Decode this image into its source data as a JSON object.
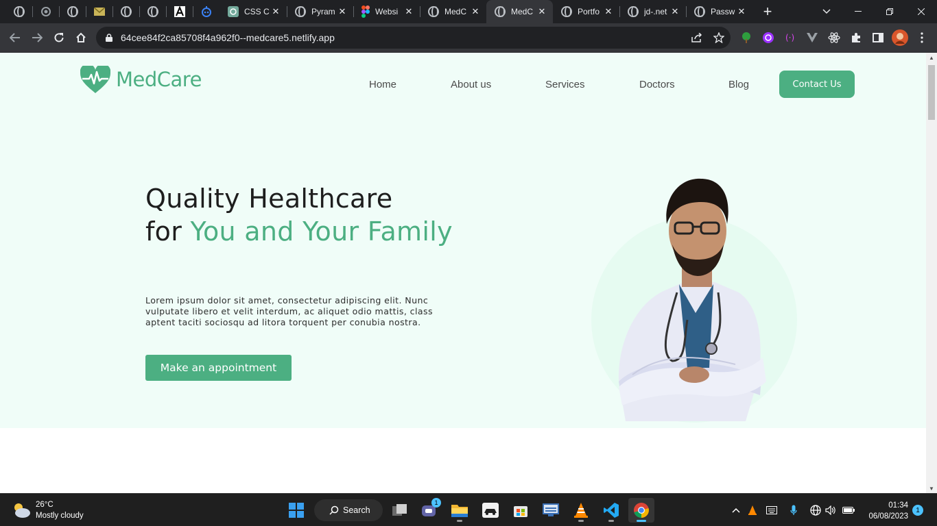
{
  "browser": {
    "tabs": [
      {
        "title": "CSS C",
        "icon": "openai-icon"
      },
      {
        "title": "Pyram",
        "icon": "globe-icon"
      },
      {
        "title": "Websi",
        "icon": "figma-icon"
      },
      {
        "title": "MedC",
        "icon": "globe-icon"
      },
      {
        "title": "MedC",
        "icon": "globe-icon",
        "active": true
      },
      {
        "title": "Portfo",
        "icon": "globe-icon"
      },
      {
        "title": "jd-.net",
        "icon": "globe-icon"
      },
      {
        "title": "Passw",
        "icon": "globe-icon"
      }
    ],
    "close_glyph": "✕",
    "new_tab_glyph": "+",
    "url": "64cee84f2ca85708f4a962f0--medcare5.netlify.app",
    "colors": {
      "tabstrip": "#202124",
      "toolbar": "#35363a"
    }
  },
  "site": {
    "brand": "MedCare",
    "nav": [
      "Home",
      "About us",
      "Services",
      "Doctors",
      "Blog"
    ],
    "contact_label": "Contact Us",
    "hero": {
      "title_line1": "Quality Healthcare",
      "title_for": "for ",
      "title_accent": "You and Your Family",
      "description": "Lorem ipsum dolor sit amet, consectetur adipiscing elit. Nunc vulputate libero et velit interdum, ac aliquet odio mattis, class aptent taciti sociosqu ad litora torquent per conubia nostra.",
      "cta": "Make an appointment"
    },
    "colors": {
      "accent": "#4caf82",
      "hero_bg": "#f0fdf8",
      "text": "#1e1e1e"
    }
  },
  "taskbar": {
    "weather_temp": "26°C",
    "weather_desc": "Mostly cloudy",
    "search_label": "Search",
    "teams_badge": "1",
    "time": "01:34",
    "date": "06/08/2023",
    "notification_count": "1"
  }
}
